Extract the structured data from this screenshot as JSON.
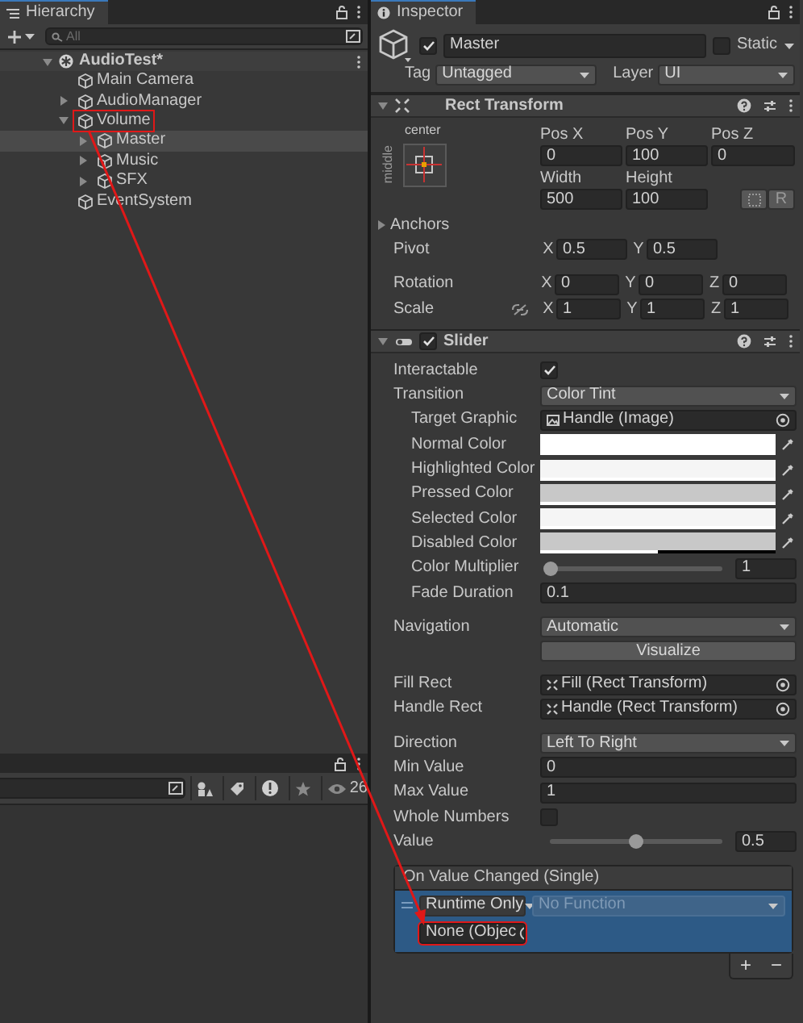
{
  "hierarchy": {
    "title": "Hierarchy",
    "search": {
      "placeholder": "All"
    },
    "scene": {
      "name": "AudioTest*",
      "expanded": true,
      "children": [
        {
          "name": "Main Camera",
          "has_children": false,
          "selected": false,
          "boxed": false
        },
        {
          "name": "AudioManager",
          "has_children": true,
          "expanded": false,
          "selected": false,
          "boxed": false
        },
        {
          "name": "Volume",
          "has_children": true,
          "expanded": true,
          "selected": false,
          "boxed": true,
          "children": [
            {
              "name": "Master",
              "has_children": true,
              "expanded": false,
              "selected": true,
              "boxed": false
            },
            {
              "name": "Music",
              "has_children": true,
              "expanded": false,
              "selected": false,
              "boxed": false
            },
            {
              "name": "SFX",
              "has_children": true,
              "expanded": false,
              "selected": false,
              "boxed": false
            }
          ]
        },
        {
          "name": "EventSystem",
          "has_children": false,
          "selected": false,
          "boxed": false
        }
      ]
    }
  },
  "project": {
    "count": "26"
  },
  "inspector": {
    "title": "Inspector",
    "object": {
      "active": true,
      "name": "Master",
      "static_label": "Static",
      "static": false,
      "tag_label": "Tag",
      "tag": "Untagged",
      "layer_label": "Layer",
      "layer": "UI"
    },
    "rect_transform": {
      "title": "Rect Transform",
      "expanded": true,
      "anchor_h": "center",
      "anchor_v": "middle",
      "pos": [
        {
          "label": "Pos X",
          "value": "0"
        },
        {
          "label": "Pos Y",
          "value": "100"
        },
        {
          "label": "Pos Z",
          "value": "0"
        }
      ],
      "size": [
        {
          "label": "Width",
          "value": "500"
        },
        {
          "label": "Height",
          "value": "100"
        }
      ],
      "raw_button": "R",
      "anchors": {
        "label": "Anchors",
        "expanded": false
      },
      "pivot": {
        "label": "Pivot",
        "axes": [
          {
            "axis": "X",
            "value": "0.5"
          },
          {
            "axis": "Y",
            "value": "0.5"
          }
        ]
      },
      "rotation": {
        "label": "Rotation",
        "axes": [
          {
            "axis": "X",
            "value": "0"
          },
          {
            "axis": "Y",
            "value": "0"
          },
          {
            "axis": "Z",
            "value": "0"
          }
        ]
      },
      "scale": {
        "label": "Scale",
        "axes": [
          {
            "axis": "X",
            "value": "1"
          },
          {
            "axis": "Y",
            "value": "1"
          },
          {
            "axis": "Z",
            "value": "1"
          }
        ]
      }
    },
    "slider": {
      "title": "Slider",
      "enabled": true,
      "expanded": true,
      "properties": [
        {
          "kind": "checkbox",
          "label": "Interactable",
          "checked": true
        },
        {
          "kind": "dropdown",
          "label": "Transition",
          "value": "Color Tint",
          "children": [
            {
              "kind": "image_ref",
              "label": "Target Graphic",
              "value": "Handle (Image)"
            },
            {
              "kind": "color",
              "label": "Normal Color",
              "color": "#ffffff",
              "level": 1
            },
            {
              "kind": "color",
              "label": "Highlighted Color",
              "color": "#f5f5f5",
              "level": 1
            },
            {
              "kind": "color",
              "label": "Pressed Color",
              "color": "#c8c8c8",
              "level": 1
            },
            {
              "kind": "color",
              "label": "Selected Color",
              "color": "#f5f5f5",
              "level": 1
            },
            {
              "kind": "color",
              "label": "Disabled Color",
              "color": "#c8c8c8",
              "level": 0.5
            },
            {
              "kind": "slider",
              "label": "Color Multiplier",
              "level": 0,
              "value": "1"
            },
            {
              "kind": "number",
              "label": "Fade Duration",
              "value": "0.1"
            }
          ]
        },
        {
          "kind": "gap"
        },
        {
          "kind": "dropdown",
          "label": "Navigation",
          "value": "Automatic"
        },
        {
          "kind": "button",
          "value": "Visualize"
        },
        {
          "kind": "gap"
        },
        {
          "kind": "rect_ref",
          "label": "Fill Rect",
          "value": "Fill (Rect Transform)"
        },
        {
          "kind": "rect_ref",
          "label": "Handle Rect",
          "value": "Handle (Rect Transform)"
        },
        {
          "kind": "gap"
        },
        {
          "kind": "dropdown",
          "label": "Direction",
          "value": "Left To Right"
        },
        {
          "kind": "number",
          "label": "Min Value",
          "value": "0"
        },
        {
          "kind": "number",
          "label": "Max Value",
          "value": "1"
        },
        {
          "kind": "checkbox",
          "label": "Whole Numbers",
          "checked": false
        },
        {
          "kind": "slider",
          "label": "Value",
          "level": 0.5,
          "value": "0.5"
        }
      ]
    },
    "event": {
      "title": "On Value Changed (Single)",
      "runtime": "Runtime Only",
      "function": "No Function",
      "function_disabled": true,
      "object": "None (Objec",
      "object_boxed": true,
      "add": "+",
      "remove": "−"
    }
  }
}
